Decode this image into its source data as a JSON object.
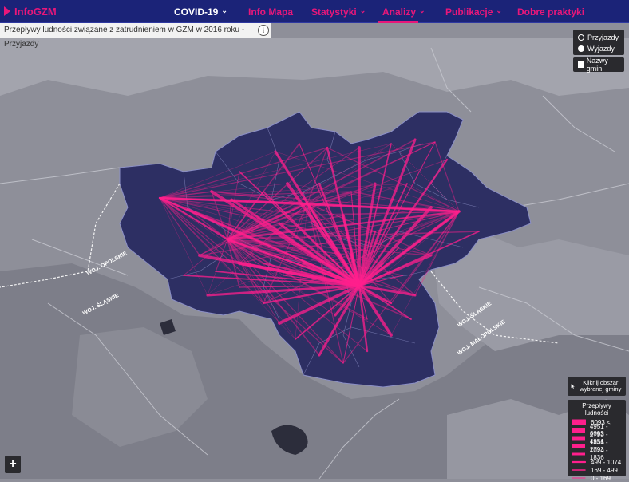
{
  "brand": {
    "name": "InfoGZM"
  },
  "nav": {
    "items": [
      {
        "label": "COVID-19",
        "has_dropdown": true,
        "active": false
      },
      {
        "label": "Info Mapa",
        "has_dropdown": false,
        "active": false
      },
      {
        "label": "Statystyki",
        "has_dropdown": true,
        "active": false
      },
      {
        "label": "Analizy",
        "has_dropdown": true,
        "active": true
      },
      {
        "label": "Publikacje",
        "has_dropdown": true,
        "active": false
      },
      {
        "label": "Dobre praktyki",
        "has_dropdown": false,
        "active": false
      }
    ],
    "chevron": "⌄"
  },
  "map_title": "Przepływy ludności związane z zatrudnieniem w GZM w 2016 roku - Przyjazdy",
  "info_icon": "i",
  "controls": {
    "options": [
      {
        "label": "Przyjazdy",
        "selected": false
      },
      {
        "label": "Wyjazdy",
        "selected": true
      }
    ],
    "municipality_names_label": "Nazwy gmin",
    "municipality_names_checked": false
  },
  "region_labels": {
    "opolskie": "WOJ. OPOLSKIE",
    "slaskie_left": "WOJ. ŚLĄSKIE",
    "slaskie_right": "WOJ. ŚLĄSKIE",
    "malopolskie": "WOJ. MAŁOPOLSKIE"
  },
  "hint": "Kliknij obszar wybranej gminy",
  "legend": {
    "title": "Przepływy ludności",
    "classes": [
      "6093 <",
      "4951 - 6093",
      "2793 - 4951",
      "1836 - 2793",
      "1074 - 1836",
      "499 - 1074",
      "169 - 499",
      "0 - 169"
    ]
  },
  "zoom_in_label": "+",
  "colors": {
    "header_bg": "#1b2378",
    "accent": "#e8177a",
    "region_fill": "#2d2f63",
    "basemap": "#8e8f99",
    "flow": "#ff1f8c",
    "panel_bg": "#2a2a2e"
  },
  "icons": {
    "brand": "chevron-right-icon",
    "info": "info-icon",
    "cursor": "cursor-icon",
    "zoom": "plus-icon"
  }
}
